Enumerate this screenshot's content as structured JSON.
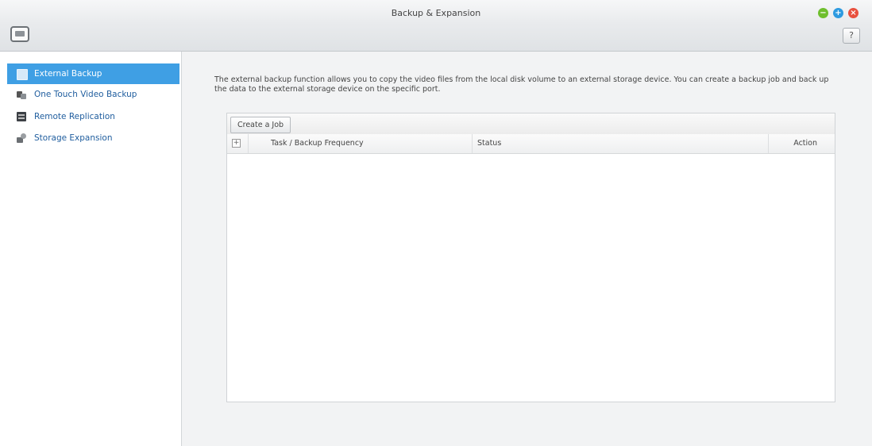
{
  "window": {
    "title": "Backup & Expansion",
    "controls": {
      "minimize": "−",
      "maximize": "+",
      "close": "×"
    },
    "help_label": "?"
  },
  "sidebar": {
    "items": [
      {
        "label": "External Backup",
        "icon": "external-backup-icon",
        "active": true
      },
      {
        "label": "One Touch Video Backup",
        "icon": "usb-backup-icon",
        "active": false
      },
      {
        "label": "Remote Replication",
        "icon": "server-icon",
        "active": false
      },
      {
        "label": "Storage Expansion",
        "icon": "storage-expansion-icon",
        "active": false
      }
    ]
  },
  "main": {
    "description": "The external backup function allows you to copy the video files from the local disk volume to an external storage device. You can create a backup job and back up the data to the external storage device on the specific port.",
    "create_button": "Create a Job",
    "table": {
      "expand_symbol": "+",
      "columns": [
        "Task / Backup Frequency",
        "Status",
        "Action"
      ],
      "rows": []
    }
  },
  "colors": {
    "accent": "#3f9fe4",
    "link": "#1f5d9e",
    "minimize": "#6fbf2e",
    "maximize": "#2d9ae0",
    "close": "#e8503e"
  }
}
